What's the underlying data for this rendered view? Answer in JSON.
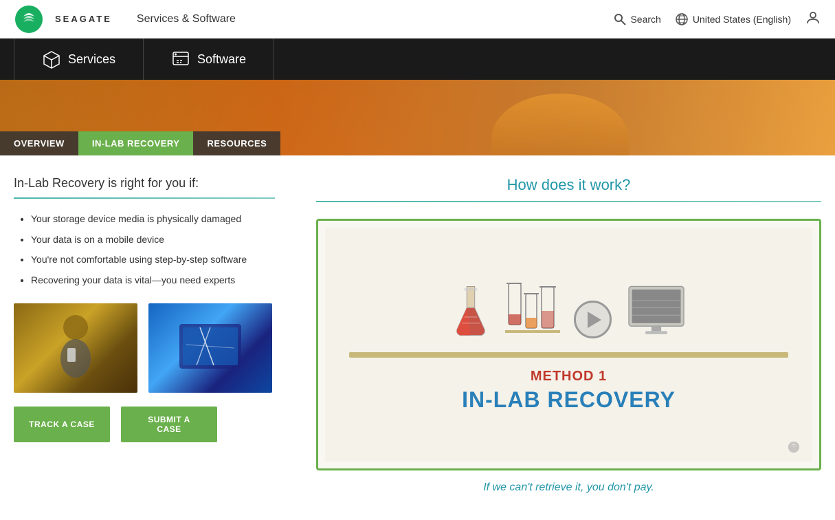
{
  "header": {
    "brand": "SEAGATE",
    "nav_title": "Services & Software",
    "search_label": "Search",
    "region_label": "United States (English)"
  },
  "nav": {
    "items": [
      {
        "id": "services",
        "label": "Services",
        "icon": "cube-icon"
      },
      {
        "id": "software",
        "label": "Software",
        "icon": "software-icon"
      }
    ]
  },
  "hero": {
    "tabs": [
      {
        "id": "overview",
        "label": "OVERVIEW",
        "active": false
      },
      {
        "id": "inlab",
        "label": "IN-LAB RECOVERY",
        "active": true
      },
      {
        "id": "resources",
        "label": "RESOURCES",
        "active": false
      }
    ]
  },
  "left": {
    "heading": "In-Lab Recovery is right for you if:",
    "bullets": [
      "Your storage device media is physically damaged",
      "Your data is on a mobile device",
      "You're not comfortable using step-by-step software",
      "Recovering your data is vital—you need experts"
    ],
    "buttons": [
      {
        "id": "track",
        "label": "TRACK A CASE"
      },
      {
        "id": "submit",
        "label": "SUBMIT A CASE"
      }
    ]
  },
  "right": {
    "heading": "How does it work?",
    "video": {
      "method_label": "METHOD 1",
      "title_label": "IN-LAB RECOVERY",
      "tagline": "If we can't retrieve it, you don't pay."
    }
  }
}
